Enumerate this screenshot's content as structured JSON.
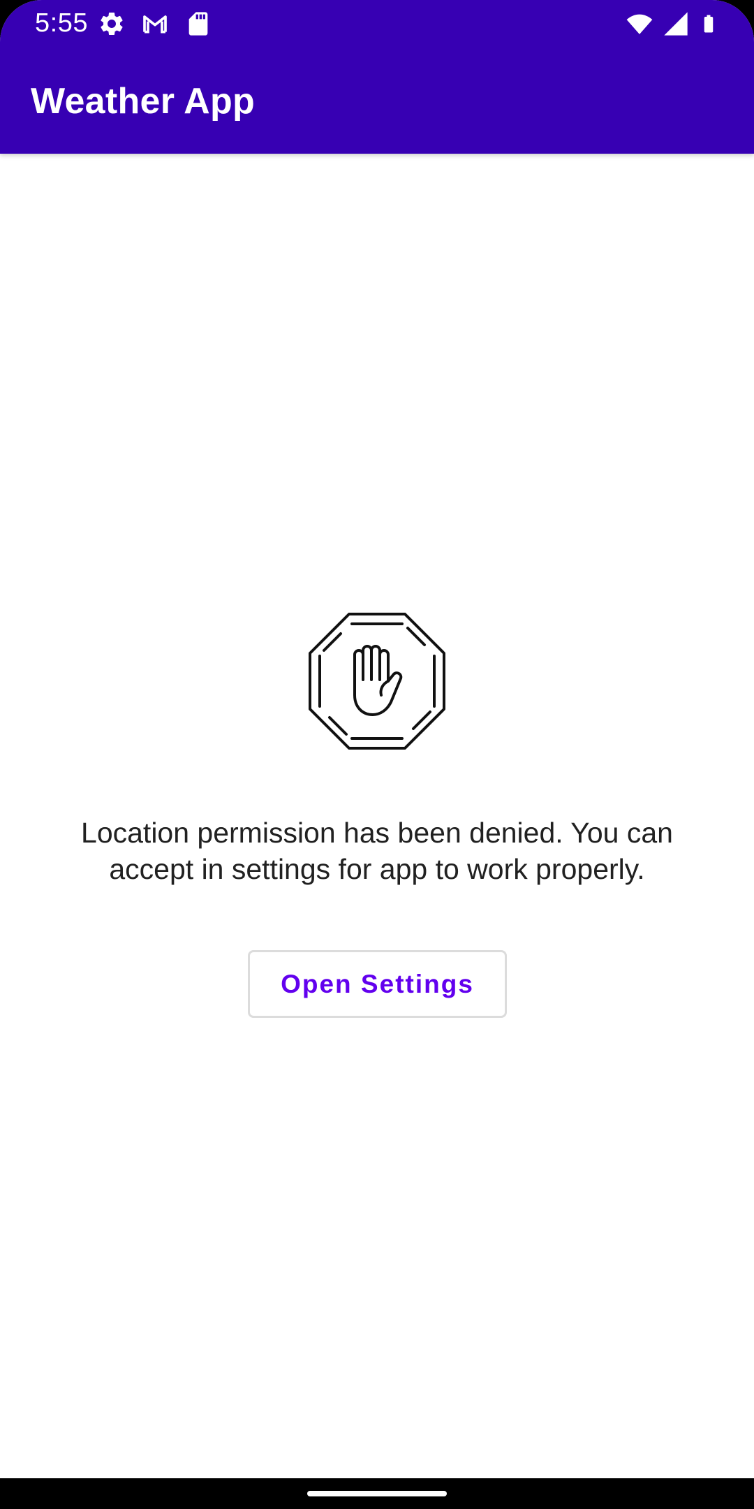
{
  "status_bar": {
    "time": "5:55",
    "left_icons": [
      "settings-icon",
      "gmail-icon",
      "sd-card-icon"
    ],
    "right_icons": [
      "wifi-icon",
      "cellular-signal-icon",
      "battery-icon"
    ]
  },
  "app_bar": {
    "title": "Weather App",
    "color": "#3700b3"
  },
  "permission": {
    "icon": "stop-hand-icon",
    "message": "Location permission has been denied. You can accept in settings for app to work properly.",
    "button_label": "Open Settings",
    "button_color": "#6200ee"
  }
}
